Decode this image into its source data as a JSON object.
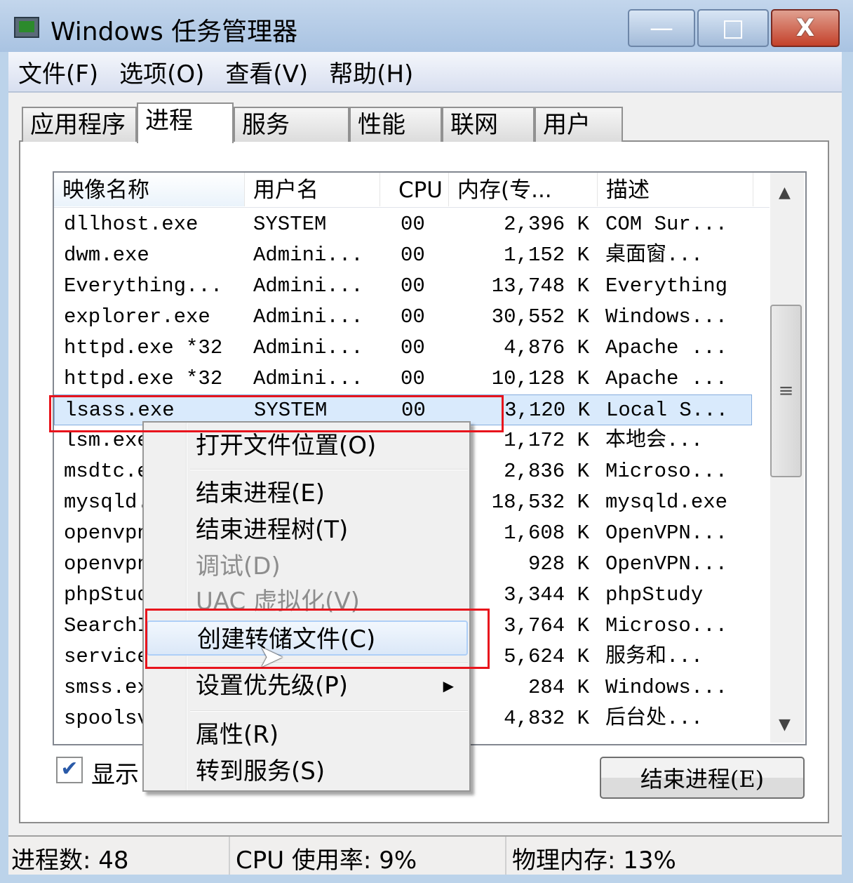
{
  "window": {
    "title": "Windows 任务管理器",
    "minimize": "—",
    "maximize": "□",
    "close": "X"
  },
  "menubar": [
    "文件(F)",
    "选项(O)",
    "查看(V)",
    "帮助(H)"
  ],
  "tabs": [
    {
      "label": "应用程序"
    },
    {
      "label": "进程",
      "active": true
    },
    {
      "label": "服务"
    },
    {
      "label": "性能"
    },
    {
      "label": "联网"
    },
    {
      "label": "用户"
    }
  ],
  "columns": [
    "映像名称",
    "用户名",
    "CPU",
    "内存(专...",
    "描述"
  ],
  "rows": [
    [
      "dllhost.exe",
      "SYSTEM",
      "00",
      "2,396 K",
      "COM Sur..."
    ],
    [
      "dwm.exe",
      "Admini...",
      "00",
      "1,152 K",
      "桌面窗..."
    ],
    [
      "Everything...",
      "Admini...",
      "00",
      "13,748 K",
      "Everything"
    ],
    [
      "explorer.exe",
      "Admini...",
      "00",
      "30,552 K",
      "Windows..."
    ],
    [
      "httpd.exe *32",
      "Admini...",
      "00",
      "4,876 K",
      "Apache ..."
    ],
    [
      "httpd.exe *32",
      "Admini...",
      "00",
      "10,128 K",
      "Apache ..."
    ],
    [
      "lsass.exe",
      "SYSTEM",
      "00",
      "3,120 K",
      "Local S..."
    ],
    [
      "lsm.exe",
      "",
      "",
      "1,172 K",
      "本地会..."
    ],
    [
      "msdtc.exe",
      "",
      "",
      "2,836 K",
      "Microso..."
    ],
    [
      "mysqld.exe",
      "",
      "",
      "18,532 K",
      "mysqld.exe"
    ],
    [
      "openvpn",
      "",
      "",
      "1,608 K",
      "OpenVPN..."
    ],
    [
      "openvpn",
      "",
      "",
      "928 K",
      "OpenVPN..."
    ],
    [
      "phpStudy",
      "",
      "",
      "3,344 K",
      "phpStudy"
    ],
    [
      "SearchIndexer",
      "",
      "",
      "3,764 K",
      "Microso..."
    ],
    [
      "services",
      "",
      "",
      "5,624 K",
      "服务和..."
    ],
    [
      "smss.exe",
      "",
      "",
      "284 K",
      "Windows..."
    ],
    [
      "spoolsv",
      "",
      "",
      "4,832 K",
      "后台处..."
    ]
  ],
  "selected_row": 6,
  "context_menu": [
    {
      "label": "打开文件位置(O)"
    },
    {
      "label": "结束进程(E)"
    },
    {
      "label": "结束进程树(T)"
    },
    {
      "label": "调试(D)",
      "disabled": true
    },
    {
      "label": "UAC 虚拟化(V)",
      "disabled": true
    },
    {
      "label": "创建转储文件(C)",
      "highlighted": true
    },
    {
      "label": "设置优先级(P)",
      "submenu": true
    },
    {
      "label": "属性(R)"
    },
    {
      "label": "转到服务(S)"
    }
  ],
  "show_all_label": "显示",
  "show_all_checked": true,
  "end_process_button": "结束进程(E)",
  "status": {
    "processes": "进程数: 48",
    "cpu": "CPU 使用率: 9%",
    "memory": "物理内存: 13%"
  },
  "colors": {
    "highlight_box": "#e8141c",
    "selection": "#d9eafc"
  }
}
